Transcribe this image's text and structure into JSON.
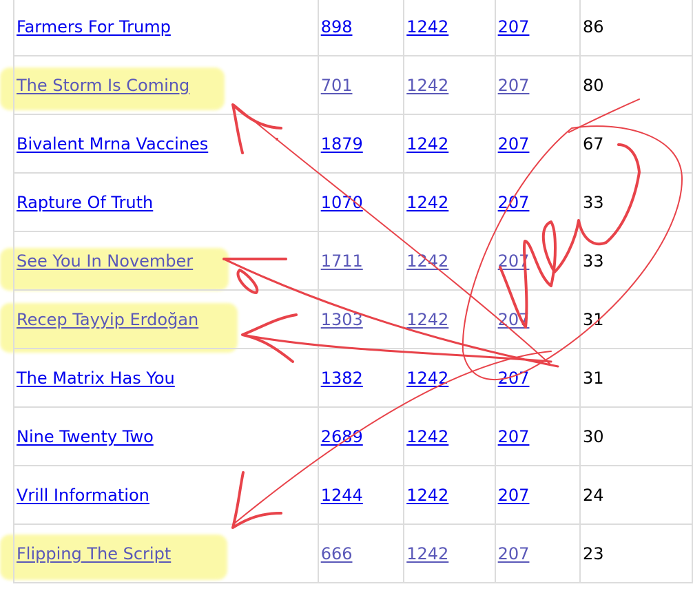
{
  "table": {
    "rows": [
      {
        "name": "Farmers For Trump",
        "col1": "898",
        "col2": "1242",
        "col3": "207",
        "count": "86",
        "highlighted": false
      },
      {
        "name": "The Storm Is Coming",
        "col1": "701",
        "col2": "1242",
        "col3": "207",
        "count": "80",
        "highlighted": true
      },
      {
        "name": "Bivalent Mrna Vaccines",
        "col1": "1879",
        "col2": "1242",
        "col3": "207",
        "count": "67",
        "highlighted": false
      },
      {
        "name": "Rapture Of Truth",
        "col1": "1070",
        "col2": "1242",
        "col3": "207",
        "count": "33",
        "highlighted": false
      },
      {
        "name": "See You In November",
        "col1": "1711",
        "col2": "1242",
        "col3": "207",
        "count": "33",
        "highlighted": true
      },
      {
        "name": "Recep Tayyip Erdoğan",
        "col1": "1303",
        "col2": "1242",
        "col3": "207",
        "count": "31",
        "highlighted": true
      },
      {
        "name": "The Matrix Has You",
        "col1": "1382",
        "col2": "1242",
        "col3": "207",
        "count": "31",
        "highlighted": false
      },
      {
        "name": "Nine Twenty Two",
        "col1": "2689",
        "col2": "1242",
        "col3": "207",
        "count": "30",
        "highlighted": false
      },
      {
        "name": "Vrill Information",
        "col1": "1244",
        "col2": "1242",
        "col3": "207",
        "count": "24",
        "highlighted": false
      },
      {
        "name": "Flipping The Script",
        "col1": "666",
        "col2": "1242",
        "col3": "207",
        "count": "23",
        "highlighted": true
      }
    ]
  },
  "annotations": {
    "handwritten_text": "WOW",
    "highlight_color": "#fbf89a",
    "ink_color": "#e8434a",
    "link_color": "#0000ee",
    "visited_link_color": "#5a58b8"
  }
}
